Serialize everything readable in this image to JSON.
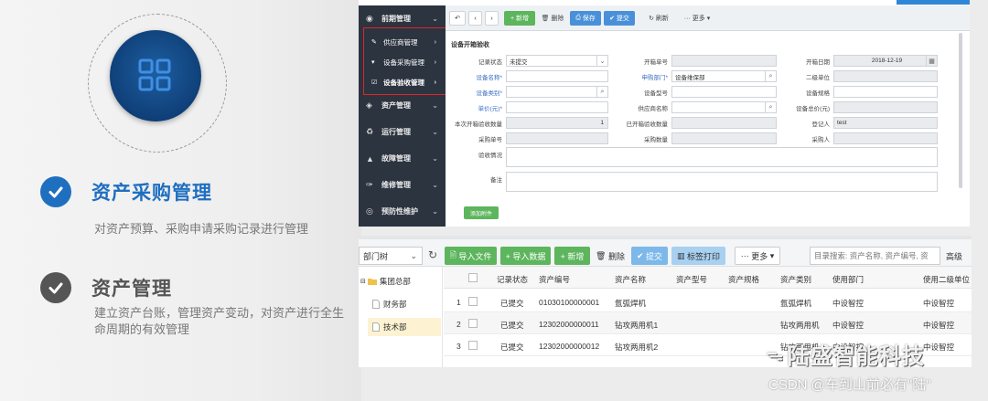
{
  "promo": {
    "features": [
      {
        "title": "资产采购管理",
        "desc": "对资产预算、采购申请采购记录进行管理",
        "color": "#1f6fc0"
      },
      {
        "title": "资产管理",
        "desc": "建立资产台账，管理资产变动，对资产进行全生命周期的有效管理",
        "color": "#555555"
      }
    ]
  },
  "app1": {
    "sidebar": {
      "items": [
        {
          "label": "前期管理",
          "icon": "globe-icon"
        },
        {
          "label": "资产管理",
          "icon": "box-icon"
        },
        {
          "label": "运行管理",
          "icon": "recycle-icon"
        },
        {
          "label": "故障管理",
          "icon": "warning-icon"
        },
        {
          "label": "维修管理",
          "icon": "wrench-icon"
        },
        {
          "label": "预防性维护",
          "icon": "gauge-icon"
        }
      ],
      "subitems": [
        {
          "label": "供应商管理",
          "icon": "link-icon"
        },
        {
          "label": "设备采购管理",
          "icon": "cart-icon"
        },
        {
          "label": "设备验收管理",
          "icon": "check-square-icon"
        }
      ]
    },
    "toolbar": {
      "add": "+ 新增",
      "delete": "删除",
      "save": "保存",
      "submit": "提交",
      "refresh": "刷新",
      "more": "更多"
    },
    "form": {
      "title": "设备开箱验收",
      "fields": {
        "record_status": {
          "label": "记录状态",
          "value": "未提交"
        },
        "box_no": {
          "label": "开箱单号",
          "value": ""
        },
        "open_date": {
          "label": "开箱日期",
          "value": "2018-12-19"
        },
        "device_name": {
          "label": "设备名称*",
          "value": ""
        },
        "apply_dept": {
          "label": "申购部门*",
          "value": "设备维保部"
        },
        "second_unit": {
          "label": "二级单位",
          "value": ""
        },
        "device_type": {
          "label": "设备类别*",
          "value": ""
        },
        "device_model": {
          "label": "设备型号",
          "value": ""
        },
        "device_spec": {
          "label": "设备规格",
          "value": ""
        },
        "unit_price": {
          "label": "单价(元)*",
          "value": ""
        },
        "supplier": {
          "label": "供应商名称",
          "value": ""
        },
        "total_price": {
          "label": "设备总价(元)",
          "value": ""
        },
        "current_count": {
          "label": "本次开箱验收数量",
          "value": "1"
        },
        "accepted_count": {
          "label": "已开箱验收数量",
          "value": ""
        },
        "registrant": {
          "label": "登记人",
          "value": "test"
        },
        "purchase_no": {
          "label": "采购单号",
          "value": ""
        },
        "purchase_count": {
          "label": "采购数量",
          "value": ""
        },
        "purchaser": {
          "label": "采购人",
          "value": ""
        },
        "acceptance": {
          "label": "验收情况",
          "value": ""
        },
        "remark": {
          "label": "备注",
          "value": ""
        }
      },
      "attach_label": "添加附件"
    }
  },
  "app2": {
    "tree_select": "部门树",
    "toolbar": {
      "import_file": "导入文件",
      "import_data": "+ 导入数据",
      "add": "+ 新增",
      "delete": "删除",
      "submit": "提交",
      "print_label": "标签打印",
      "more": "更多"
    },
    "search_placeholder": "目录搜索: 资产名称, 资产编号, 资",
    "advanced": "高级",
    "tree": {
      "root": "集团总部",
      "children": [
        "财务部",
        "技术部"
      ]
    },
    "table": {
      "columns": [
        "记录状态",
        "资产编号",
        "资产名称",
        "资产型号",
        "资产规格",
        "资产类别",
        "使用部门",
        "使用二级单位"
      ],
      "rows": [
        {
          "no": "1",
          "status": "已提交",
          "code": "01030100000001",
          "name": "氩弧焊机",
          "model": "",
          "spec": "",
          "type": "氩弧焊机",
          "dept": "中设智控",
          "unit": "中设智控"
        },
        {
          "no": "2",
          "status": "已提交",
          "code": "12302000000011",
          "name": "钻攻两用机1",
          "model": "",
          "spec": "",
          "type": "钻攻两用机",
          "dept": "中设智控",
          "unit": "中设智控"
        },
        {
          "no": "3",
          "status": "已提交",
          "code": "12302000000012",
          "name": "钻攻两用机2",
          "model": "",
          "spec": "",
          "type": "钻攻两用机",
          "dept": "中设智控",
          "unit": "中设智控"
        }
      ]
    }
  },
  "watermark": {
    "brand": "陆盛智能科技",
    "source": "CSDN @车到山前必有\"陆\""
  }
}
